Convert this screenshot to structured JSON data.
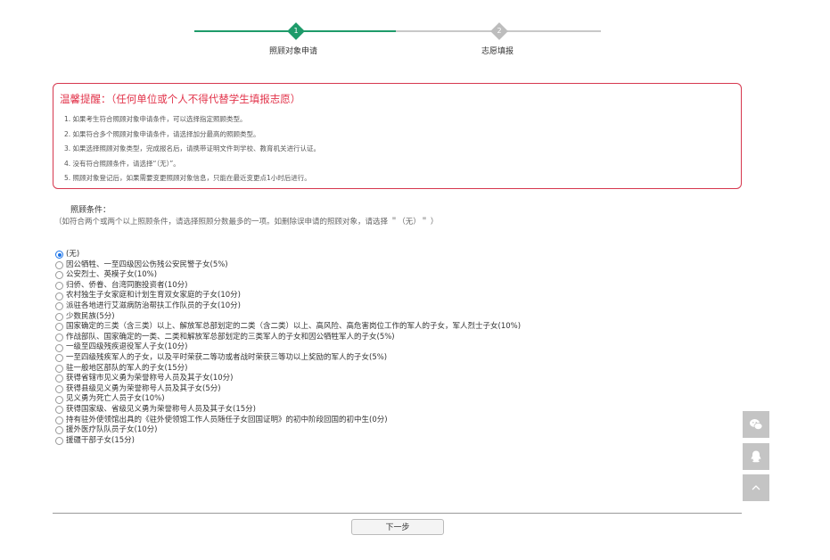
{
  "stepper": {
    "steps": [
      {
        "number": "1",
        "label": "照顾对象申请"
      },
      {
        "number": "2",
        "label": "志愿填报"
      }
    ],
    "active_color": "#1e9b6a",
    "inactive_color": "#bdbdbd"
  },
  "notice": {
    "title": "温馨提醒：（任何单位或个人不得代替学生填报志愿）",
    "items": [
      "1. 如果考生符合照顾对象申请条件，可以选择指定照顾类型。",
      "2. 如果符合多个照顾对象申请条件，请选择加分最高的照顾类型。",
      "3. 如果选择照顾对象类型，完成报名后，请携带证明文件到学校、教育机关进行认证。",
      "4. 没有符合照顾条件，请选择“（无）”。",
      "5. 照顾对象登记后，如果需要变更照顾对象信息，只能在最近变更点1小时后进行。"
    ],
    "border_color": "#d6374e"
  },
  "conditions": {
    "title": "照顾条件：",
    "hint": "（如符合两个或两个以上照顾条件，请选择照顾分数最多的一项。如删除误申请的照顾对象，请选择 ＂（无）＂ ）",
    "options": [
      {
        "label": "(无)",
        "checked": true
      },
      {
        "label": "因公牺牲、一至四级因公伤残公安民警子女(5%)",
        "checked": false
      },
      {
        "label": "公安烈士、英模子女(10%)",
        "checked": false
      },
      {
        "label": "归侨、侨眷、台湾同胞投资者(10分)",
        "checked": false
      },
      {
        "label": "农村独生子女家庭和计划生育双女家庭的子女(10分)",
        "checked": false
      },
      {
        "label": "派驻各地进行艾滋病防治帮扶工作队员的子女(10分)",
        "checked": false
      },
      {
        "label": "少数民族(5分)",
        "checked": false
      },
      {
        "label": "国家确定的三类（含三类）以上、解放军总部划定的二类（含二类）以上、高风险、高危害岗位工作的军人的子女，军人烈士子女(10%)",
        "checked": false
      },
      {
        "label": "作战部队、国家确定的一类、二类和解放军总部划定的三类军人的子女和因公牺牲军人的子女(5%)",
        "checked": false
      },
      {
        "label": "一级至四级残疾退役军人子女(10分)",
        "checked": false
      },
      {
        "label": "一至四级残疾军人的子女，以及平时荣获二等功或者战时荣获三等功以上奖励的军人的子女(5%)",
        "checked": false
      },
      {
        "label": "驻一般地区部队的军人的子女(15分)",
        "checked": false
      },
      {
        "label": "获得省辖市见义勇为荣誉称号人员及其子女(10分)",
        "checked": false
      },
      {
        "label": "获得县级见义勇为荣誉称号人员及其子女(5分)",
        "checked": false
      },
      {
        "label": "见义勇为死亡人员子女(10%)",
        "checked": false
      },
      {
        "label": "获得国家级、省级见义勇为荣誉称号人员及其子女(15分)",
        "checked": false
      },
      {
        "label": "持有驻外使领馆出具的《驻外使领馆工作人员随任子女回国证明》的初中阶段回国的初中生(0分)",
        "checked": false
      },
      {
        "label": "援外医疗队队员子女(10分)",
        "checked": false
      },
      {
        "label": "援疆干部子女(15分)",
        "checked": false
      }
    ]
  },
  "next_button": {
    "label": "下一步"
  },
  "float_buttons": [
    "wechat-icon",
    "qq-icon",
    "back-to-top-icon"
  ]
}
